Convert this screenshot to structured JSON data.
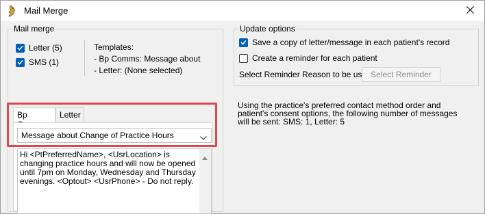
{
  "window": {
    "title": "Mail Merge"
  },
  "mail_merge": {
    "legend": "Mail merge",
    "letter": {
      "label": "Letter (5)",
      "checked": true
    },
    "sms": {
      "label": "SMS  (1)",
      "checked": true
    },
    "templates_heading": "Templates:",
    "templates": [
      "- Bp Comms: Message about",
      "- Letter: (None selected)"
    ]
  },
  "update_options": {
    "legend": "Update options",
    "save_copy": {
      "label": "Save a copy of letter/message in each patient's record",
      "checked": true
    },
    "create_reminder": {
      "label": "Create a reminder for each patient",
      "checked": false
    },
    "reason_label": "Select Reminder Reason to be used:",
    "select_reminder_button": "Select Reminder"
  },
  "info_text": "Using the practice's preferred contact method order and patient's consent options, the following number of messages will be sent: SMS: 1, Letter: 5",
  "tabs": [
    {
      "label": "Bp Comms",
      "active": true
    },
    {
      "label": "Letter",
      "active": false
    }
  ],
  "template_select": {
    "value": "Message about Change of Practice Hours"
  },
  "message_body": "Hi <PtPreferredName>, <UsrLocation> is changing practice hours and will now be opened until 7pm on Monday, Wednesday and Thursday evenings. <Optout> <UsrPhone> - Do not reply.",
  "colors": {
    "accent": "#005fb8",
    "highlight": "#e0474c"
  }
}
